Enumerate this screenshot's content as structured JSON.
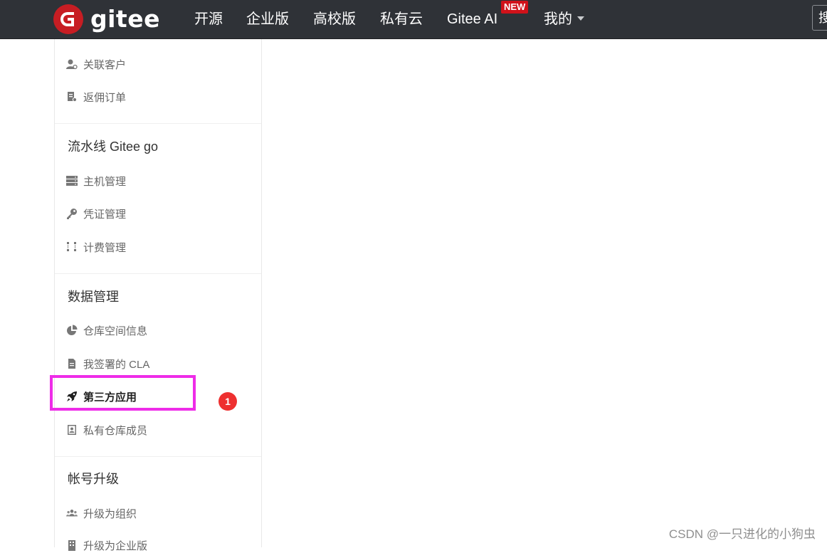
{
  "navbar": {
    "brand": "gitee",
    "logo_letter": "G",
    "items": [
      "开源",
      "企业版",
      "高校版",
      "私有云",
      "Gitee AI"
    ],
    "new_badge": "NEW",
    "mine": "我的",
    "search_placeholder": "搜"
  },
  "sidebar": {
    "items_top": [
      {
        "label": "关联客户",
        "icon": "user-link-icon"
      },
      {
        "label": "返佣订单",
        "icon": "order-icon"
      }
    ],
    "section_pipeline": {
      "title": "流水线 Gitee go",
      "items": [
        {
          "label": "主机管理",
          "icon": "server-icon"
        },
        {
          "label": "凭证管理",
          "icon": "key-icon"
        },
        {
          "label": "计费管理",
          "icon": "billing-icon"
        }
      ]
    },
    "section_data": {
      "title": "数据管理",
      "items": [
        {
          "label": "仓库空间信息",
          "icon": "pie-chart-icon"
        },
        {
          "label": "我签署的 CLA",
          "icon": "document-icon"
        },
        {
          "label": "第三方应用",
          "icon": "rocket-icon"
        },
        {
          "label": "私有仓库成员",
          "icon": "contact-book-icon"
        }
      ]
    },
    "section_upgrade": {
      "title": "帐号升级",
      "items": [
        {
          "label": "升级为组织",
          "icon": "group-icon"
        },
        {
          "label": "升级为企业版",
          "icon": "building-icon"
        }
      ]
    }
  },
  "annotation": {
    "step_number": "1",
    "highlight_color": "#ee2ce8",
    "badge_color": "#ee3030"
  },
  "watermark": "CSDN @一只进化的小狗虫",
  "colors": {
    "navbar_bg": "#2f3237",
    "brand_red": "#c71d23"
  }
}
